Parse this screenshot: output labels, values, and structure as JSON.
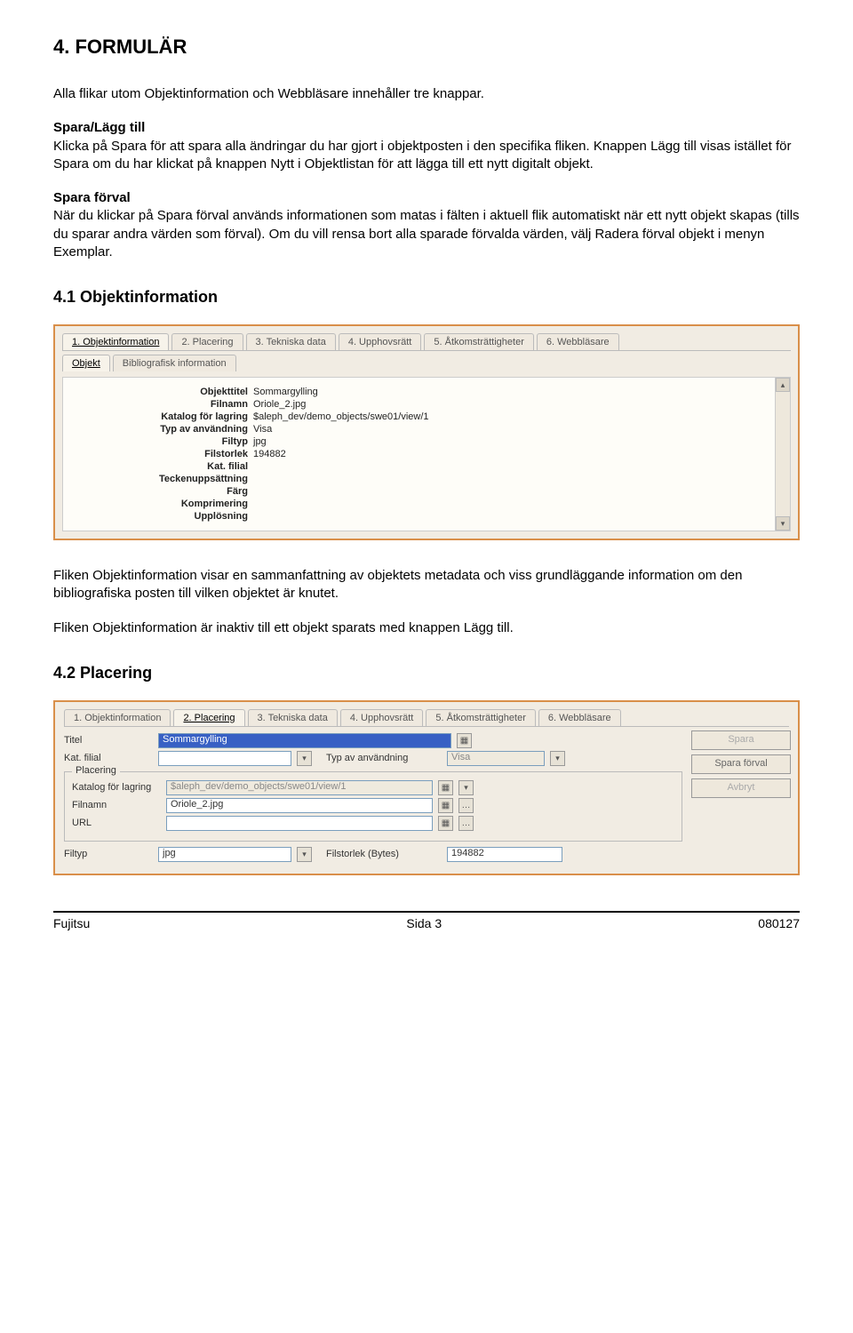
{
  "doc": {
    "h1": "4. FORMULÄR",
    "p1": "Alla flikar utom Objektinformation och Webbläsare innehåller tre knappar.",
    "h_spara_lagg": "Spara/Lägg till",
    "p2": "Klicka på Spara för att spara alla ändringar du har gjort i objektposten i den specifika fliken. Knappen Lägg till visas istället för Spara om du har klickat på knappen Nytt i Objektlistan för att lägga till ett nytt digitalt objekt.",
    "h_spara_forval": "Spara förval",
    "p3": "När du klickar på Spara förval används informationen som matas i fälten i aktuell flik automatiskt när ett nytt objekt skapas (tills du sparar andra värden som förval). Om du vill rensa bort alla sparade förvalda värden, välj Radera förval objekt i menyn Exemplar.",
    "h_41": "4.1 Objektinformation",
    "p4": "Fliken Objektinformation visar en sammanfattning av objektets metadata och viss grundläggande information om den bibliografiska posten till vilken objektet är knutet.",
    "p5": "Fliken Objektinformation är inaktiv till ett objekt sparats med knappen Lägg till.",
    "h_42": "4.2 Placering"
  },
  "tabs1": [
    "1. Objektinformation",
    "2. Placering",
    "3. Tekniska data",
    "4. Upphovsrätt",
    "5. Åtkomsträttigheter",
    "6. Webbläsare"
  ],
  "subtabs1": [
    "Objekt",
    "Bibliografisk information"
  ],
  "info_rows": [
    {
      "label": "Objekttitel",
      "value": "Sommargylling"
    },
    {
      "label": "Filnamn",
      "value": "Oriole_2.jpg"
    },
    {
      "label": "Katalog för lagring",
      "value": "$aleph_dev/demo_objects/swe01/view/1"
    },
    {
      "label": "Typ av användning",
      "value": "Visa"
    },
    {
      "label": "Filtyp",
      "value": "jpg"
    },
    {
      "label": "Filstorlek",
      "value": "194882"
    },
    {
      "label": "Kat. filial",
      "value": ""
    },
    {
      "label": "Teckenuppsättning",
      "value": ""
    },
    {
      "label": "Färg",
      "value": ""
    },
    {
      "label": "Komprimering",
      "value": ""
    },
    {
      "label": "Upplösning",
      "value": ""
    }
  ],
  "tabs2": [
    "1. Objektinformation",
    "2. Placering",
    "3. Tekniska data",
    "4. Upphovsrätt",
    "5. Åtkomsträttigheter",
    "6. Webbläsare"
  ],
  "form": {
    "titel_label": "Titel",
    "titel_value": "Sommargylling",
    "katfilial_label": "Kat. filial",
    "katfilial_value": "",
    "typ_label": "Typ av användning",
    "typ_value": "Visa",
    "placering_legend": "Placering",
    "katalog_label": "Katalog för lagring",
    "katalog_value": "$aleph_dev/demo_objects/swe01/view/1",
    "filnamn_label": "Filnamn",
    "filnamn_value": "Oriole_2.jpg",
    "url_label": "URL",
    "url_value": "",
    "filtyp_label": "Filtyp",
    "filtyp_value": "jpg",
    "filstorlek_label": "Filstorlek (Bytes)",
    "filstorlek_value": "194882"
  },
  "buttons": {
    "spara": "Spara",
    "spara_forval": "Spara förval",
    "avbryt": "Avbryt"
  },
  "footer": {
    "left": "Fujitsu",
    "center": "Sida 3",
    "right": "080127"
  }
}
